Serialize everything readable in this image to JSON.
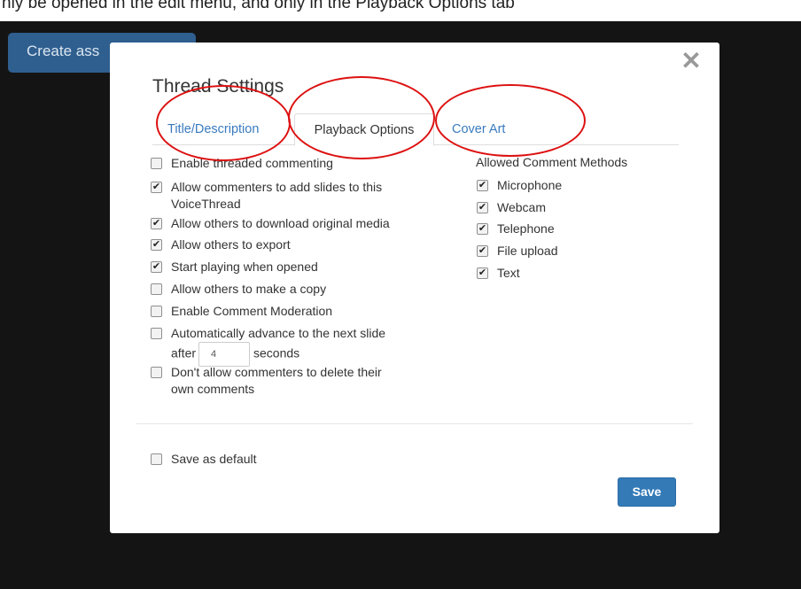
{
  "caption": {
    "text": "nly be opened in the edit menu, and only in the Playback Options tab"
  },
  "create_button": {
    "label": "Create ass"
  },
  "modal": {
    "title": "Thread Settings",
    "close_label": "✕",
    "tabs": [
      {
        "label": "Title/Description",
        "active": false
      },
      {
        "label": "Playback Options",
        "active": true
      },
      {
        "label": "Cover Art",
        "active": false
      }
    ],
    "options": [
      {
        "label": "Enable threaded commenting",
        "checked": false
      },
      {
        "label": "Allow commenters to add slides to this",
        "label2": "VoiceThread",
        "checked": true
      },
      {
        "label": "Allow others to download original media",
        "checked": true
      },
      {
        "label": "Allow others to export",
        "checked": true
      },
      {
        "label": "Start playing when opened",
        "checked": true
      },
      {
        "label": "Allow others to make a copy",
        "checked": false
      },
      {
        "label": "Enable Comment Moderation",
        "checked": false
      },
      {
        "label": "Automatically advance to the next slide",
        "prefix": "after",
        "value": "4",
        "suffix": "seconds",
        "checked": false
      },
      {
        "label": "Don't allow commenters to delete their",
        "label2": "own comments",
        "checked": false
      }
    ],
    "methods_heading": "Allowed Comment Methods",
    "methods": [
      {
        "label": "Microphone",
        "checked": true
      },
      {
        "label": "Webcam",
        "checked": true
      },
      {
        "label": "Telephone",
        "checked": true
      },
      {
        "label": "File upload",
        "checked": true
      },
      {
        "label": "Text",
        "checked": true
      }
    ],
    "save_default": {
      "label": "Save as default",
      "checked": false
    },
    "save_button": "Save"
  },
  "colors": {
    "link": "#3a7bbf",
    "primary": "#337ab7",
    "annotation": "#dd1111",
    "backdrop": "#141414"
  }
}
